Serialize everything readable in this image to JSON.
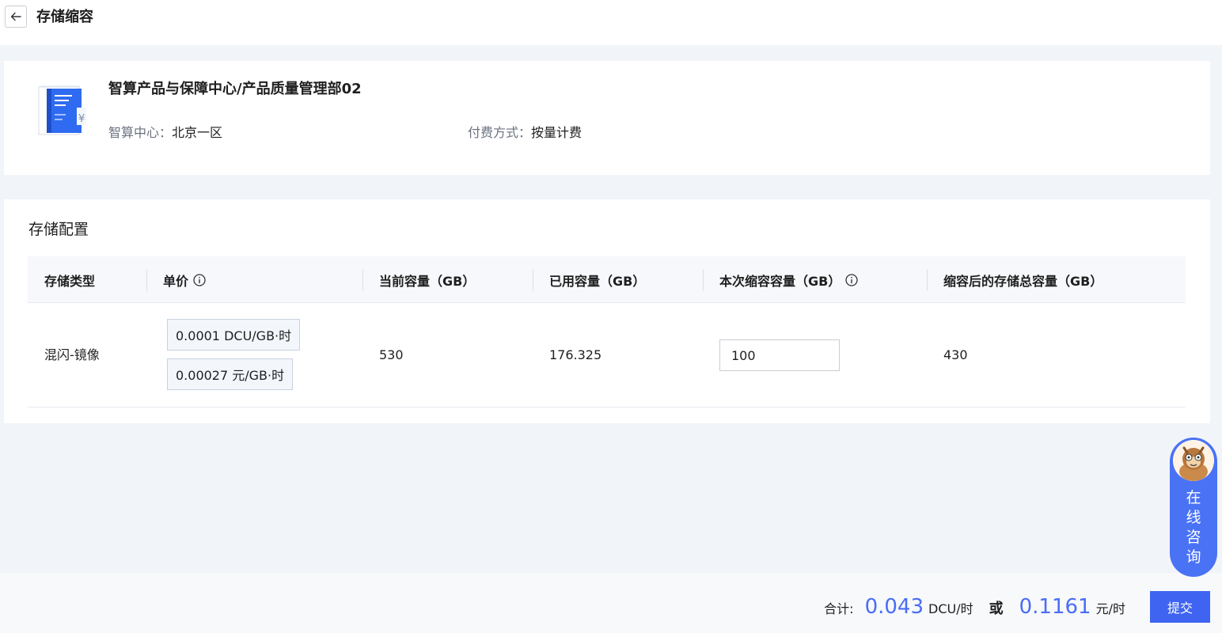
{
  "header": {
    "title": "存储缩容",
    "back_icon": "arrow-left-icon"
  },
  "info": {
    "title": "智算产品与保障中心/产品质量管理部02",
    "center_label": "智算中心：",
    "center_value": "北京一区",
    "billing_label": "付费方式：",
    "billing_value": "按量计费",
    "icon": "storage-product-icon"
  },
  "config": {
    "section_title": "存储配置",
    "columns": [
      "存储类型",
      "单价",
      "当前容量（GB）",
      "已用容量（GB）",
      "本次缩容容量（GB）",
      "缩容后的存储总容量（GB）"
    ],
    "row": {
      "type": "混闪-镜像",
      "price_dcu": "0.0001 DCU/GB·时",
      "price_yuan": "0.00027 元/GB·时",
      "current": "530",
      "used": "176.325",
      "shrink_value": "100",
      "after": "430"
    }
  },
  "footer": {
    "total_label": "合计:",
    "dcu_value": "0.043",
    "dcu_unit": "DCU/时",
    "or_label": "或",
    "yuan_value": "0.1161",
    "yuan_unit": "元/时",
    "submit_label": "提交"
  },
  "consult": {
    "chars": [
      "在",
      "线",
      "咨",
      "询"
    ]
  },
  "colors": {
    "accent": "#3f64f1",
    "price_value": "#4a6cf7",
    "background": "#f1f4f8"
  }
}
